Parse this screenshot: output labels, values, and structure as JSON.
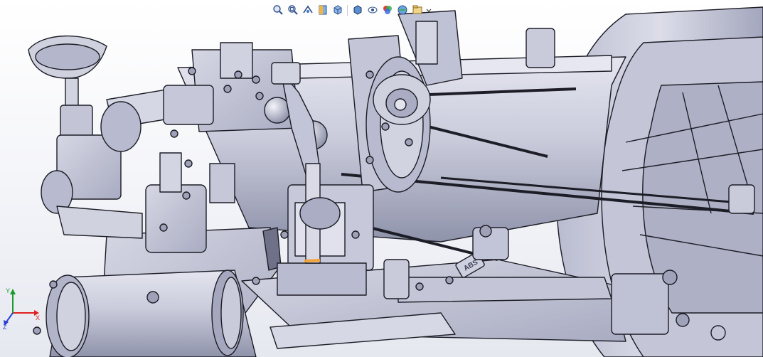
{
  "window": {
    "width": 1073,
    "height": 502
  },
  "heads_up_toolbar": {
    "tools": [
      {
        "id": "zoom-to-fit",
        "icon": "zoom-to-fit-icon"
      },
      {
        "id": "zoom-to-area",
        "icon": "zoom-to-area-icon"
      },
      {
        "id": "previous-view",
        "icon": "previous-view-icon"
      },
      {
        "id": "section-view",
        "icon": "section-view-icon"
      },
      {
        "id": "view-orientation",
        "icon": "view-orientation-icon"
      },
      {
        "id": "display-style",
        "icon": "display-style-icon"
      },
      {
        "id": "hide-show-items",
        "icon": "hide-show-items-icon"
      },
      {
        "id": "edit-appearance",
        "icon": "edit-appearance-icon"
      },
      {
        "id": "apply-scene",
        "icon": "apply-scene-icon"
      },
      {
        "id": "view-settings",
        "icon": "view-settings-icon"
      }
    ]
  },
  "triad": {
    "x_label": "X",
    "y_label": "Y",
    "z_label": "Z"
  },
  "model": {
    "embossed_plate_text": "ABS",
    "colors": {
      "body": "#c9cbdb",
      "body_light": "#e3e4ee",
      "body_dark": "#9a9db3",
      "edge": "#1c1d26",
      "highlight": "#f2a23a",
      "axis_x": "#e02020",
      "axis_y": "#1a9a2a",
      "axis_z": "#2a3fd0"
    }
  }
}
